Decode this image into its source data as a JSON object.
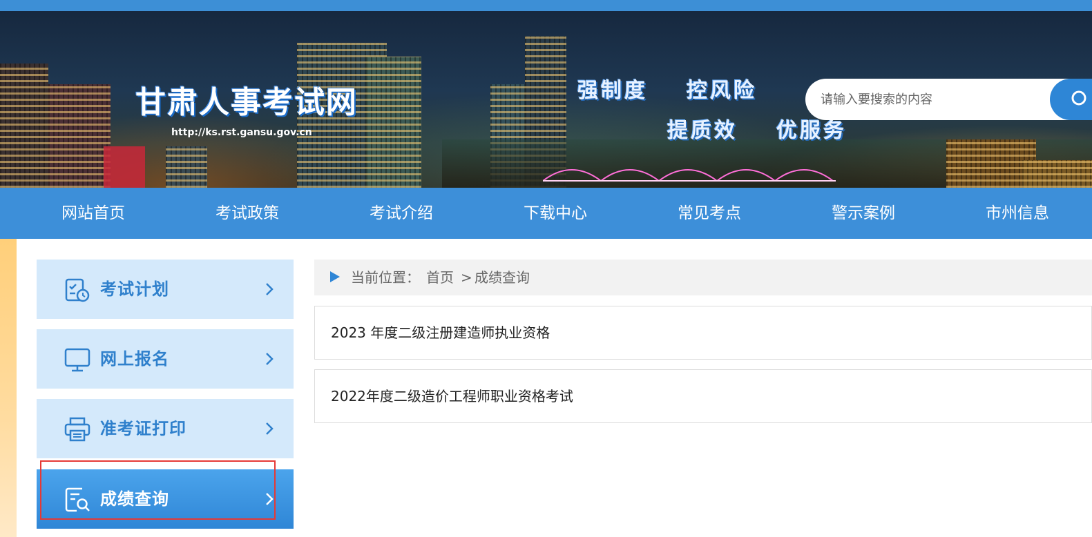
{
  "site": {
    "title": "甘肃人事考试网",
    "url": "http://ks.rst.gansu.gov.cn"
  },
  "slogans": [
    "强制度",
    "控风险",
    "提质效",
    "优服务"
  ],
  "search": {
    "placeholder": "请输入要搜索的内容",
    "icon": "search-icon"
  },
  "nav": {
    "items": [
      "网站首页",
      "考试政策",
      "考试介绍",
      "下载中心",
      "常见考点",
      "警示案例",
      "市州信息"
    ]
  },
  "sidebar": {
    "items": [
      {
        "label": "考试计划",
        "icon": "calendar-clock-icon",
        "active": false
      },
      {
        "label": "网上报名",
        "icon": "monitor-icon",
        "active": false
      },
      {
        "label": "准考证打印",
        "icon": "printer-icon",
        "active": false
      },
      {
        "label": "成绩查询",
        "icon": "score-search-icon",
        "active": true
      }
    ]
  },
  "breadcrumb": {
    "prefix": "当前位置：",
    "home": "首页",
    "separator": ">",
    "current": "成绩查询"
  },
  "results": [
    "2023 年度二级注册建造师执业资格",
    "2022年度二级造价工程师职业资格考试"
  ],
  "colors": {
    "nav": "#3d8fd9",
    "sidebar_bg": "#d4e9fb",
    "sidebar_text": "#2f80cc",
    "sidebar_active": "#3590dd",
    "highlight_box": "#e53935"
  }
}
